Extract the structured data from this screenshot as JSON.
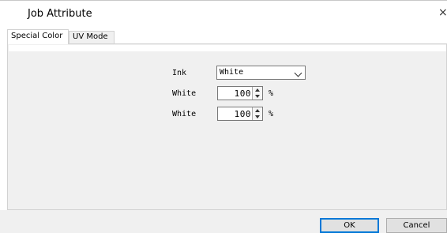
{
  "window": {
    "title": "Job Attribute",
    "close_glyph": "×"
  },
  "tabs": [
    {
      "label": "Special Color",
      "active": true
    },
    {
      "label": "UV Mode",
      "active": false
    }
  ],
  "form": {
    "ink_label": "Ink",
    "ink_value": "White",
    "rows": [
      {
        "label": "White",
        "value": "100",
        "unit": "%"
      },
      {
        "label": "White",
        "value": "100",
        "unit": "%"
      }
    ]
  },
  "buttons": {
    "ok": "OK",
    "cancel": "Cancel"
  }
}
